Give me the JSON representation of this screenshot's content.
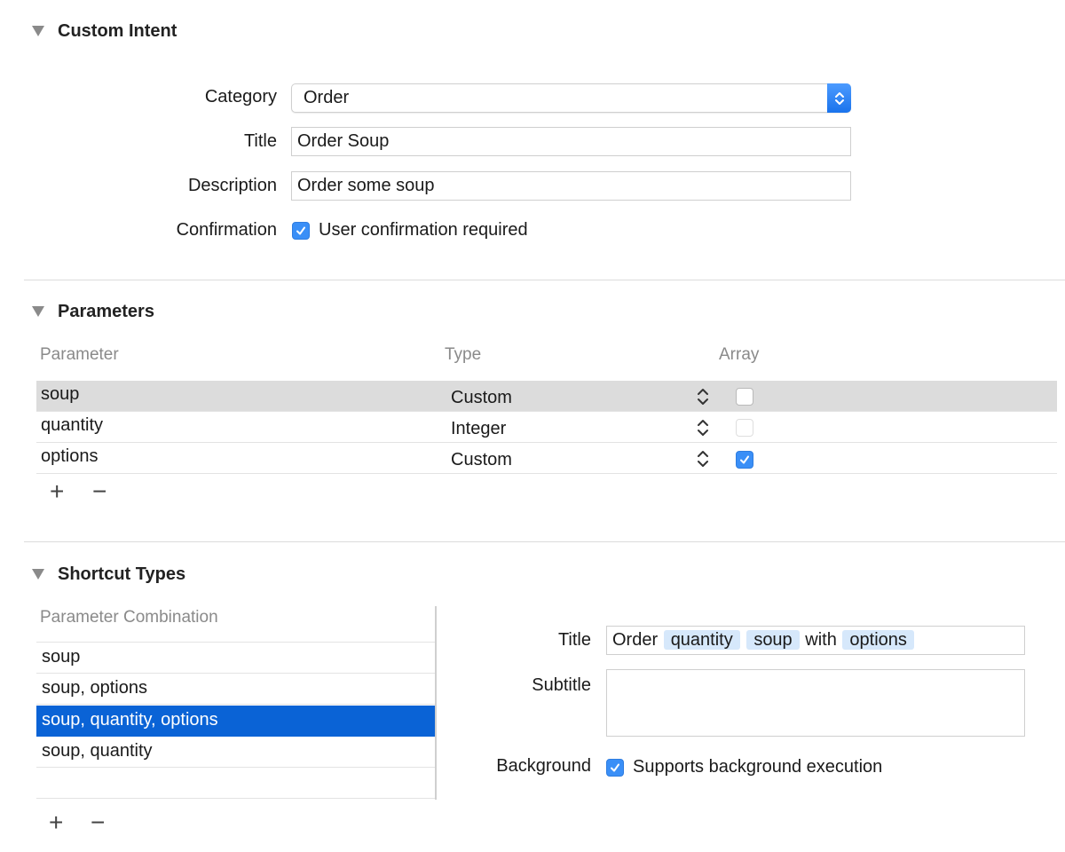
{
  "custom_intent": {
    "title": "Custom Intent",
    "category_label": "Category",
    "category_value": "Order",
    "title_label": "Title",
    "title_value": "Order Soup",
    "description_label": "Description",
    "description_value": "Order some soup",
    "confirmation_label": "Confirmation",
    "confirmation_checkbox_label": "User confirmation required",
    "confirmation_checked": true
  },
  "parameters": {
    "title": "Parameters",
    "headers": {
      "parameter": "Parameter",
      "type": "Type",
      "array": "Array"
    },
    "rows": [
      {
        "name": "soup",
        "type": "Custom",
        "array": false,
        "selected": true
      },
      {
        "name": "quantity",
        "type": "Integer",
        "array": false,
        "selected": false
      },
      {
        "name": "options",
        "type": "Custom",
        "array": true,
        "selected": false
      }
    ],
    "add_label": "+",
    "remove_label": "−"
  },
  "shortcut_types": {
    "title": "Shortcut Types",
    "combination_header": "Parameter Combination",
    "combinations": [
      {
        "label": "soup",
        "selected": false
      },
      {
        "label": "soup, options",
        "selected": false
      },
      {
        "label": "soup, quantity, options",
        "selected": true
      },
      {
        "label": "soup, quantity",
        "selected": false
      }
    ],
    "add_label": "+",
    "remove_label": "−",
    "title_label": "Title",
    "title_parts": [
      {
        "text": "Order",
        "token": false
      },
      {
        "text": "quantity",
        "token": true
      },
      {
        "text": "soup",
        "token": true
      },
      {
        "text": "with",
        "token": false
      },
      {
        "text": "options",
        "token": true
      }
    ],
    "subtitle_label": "Subtitle",
    "subtitle_value": "",
    "background_label": "Background",
    "background_checkbox_label": "Supports background execution",
    "background_checked": true
  },
  "colors": {
    "accent": "#3a8ff7",
    "selection": "#0a63d6",
    "token": "#d6e8fb",
    "row_highlight": "#dcdcdc"
  }
}
